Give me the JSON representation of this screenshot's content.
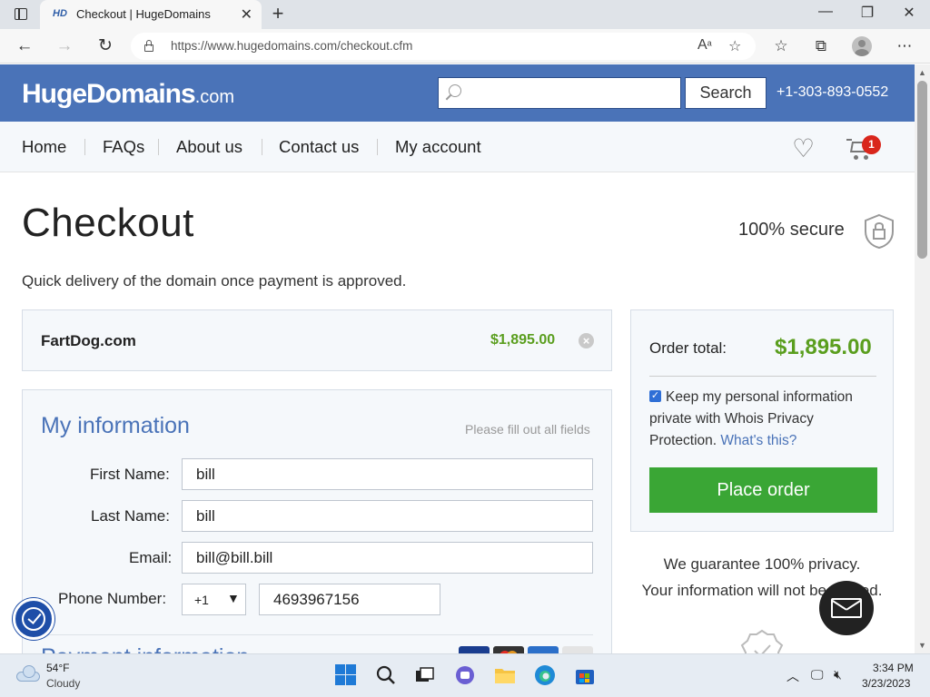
{
  "browser": {
    "tab_title": "Checkout | HugeDomains",
    "tab_favicon": "HD",
    "url": "https://www.hugedomains.com/checkout.cfm"
  },
  "site": {
    "logo_main": "HugeDomains",
    "logo_suffix": ".com",
    "search_placeholder": "",
    "search_button": "Search",
    "phone": "+1-303-893-0552",
    "nav": [
      "Home",
      "FAQs",
      "About us",
      "Contact us",
      "My account"
    ],
    "cart_count": "1"
  },
  "checkout": {
    "title": "Checkout",
    "secure_label": "100% secure",
    "subtitle": "Quick delivery of the domain once payment is approved.",
    "item": {
      "name": "FartDog.com",
      "price": "$1,895.00"
    },
    "my_info": {
      "title": "My information",
      "hint": "Please fill out all fields",
      "first_name_label": "First Name:",
      "first_name": "bill",
      "last_name_label": "Last Name:",
      "last_name": "bill",
      "email_label": "Email:",
      "email": "bill@bill.bill",
      "phone_label": "Phone Number:",
      "country_code": "+1",
      "phone": "4693967156"
    },
    "payment_title": "Payment information",
    "order": {
      "label": "Order total:",
      "total": "$1,895.00",
      "privacy_checked": true,
      "privacy_text": "Keep my personal information private with Whois Privacy Protection.",
      "privacy_link": "What's this?",
      "button": "Place order"
    },
    "guarantee_line1": "We guarantee 100% privacy.",
    "guarantee_line2": "Your information will not be shared."
  },
  "taskbar": {
    "temp": "54°F",
    "condition": "Cloudy",
    "time": "3:34 PM",
    "date": "3/23/2023"
  },
  "colors": {
    "brand_blue": "#4a73b8",
    "price_green": "#5a9e1e",
    "button_green": "#3aa635",
    "badge_red": "#d9261c"
  }
}
